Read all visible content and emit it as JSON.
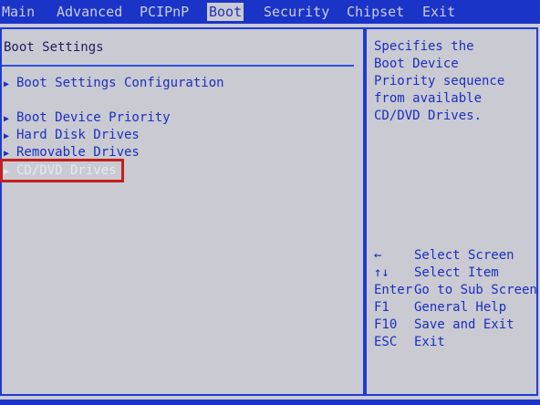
{
  "tabs": [
    {
      "label": "Main"
    },
    {
      "label": "Advanced"
    },
    {
      "label": "PCIPnP"
    },
    {
      "label": "Boot"
    },
    {
      "label": "Security"
    },
    {
      "label": "Chipset"
    },
    {
      "label": "Exit"
    }
  ],
  "active_tab": "Boot",
  "left_panel": {
    "title": "Boot Settings",
    "arrow_icon": "▶",
    "items": [
      {
        "label": "Boot Settings Configuration"
      },
      {
        "label": "Boot Device Priority"
      },
      {
        "label": "Hard Disk Drives"
      },
      {
        "label": "Removable Drives"
      },
      {
        "label": "CD/DVD Drives"
      }
    ],
    "selected_index": 4
  },
  "right_panel": {
    "help": "Specifies the\nBoot Device\nPriority sequence\nfrom available\nCD/DVD Drives.",
    "keys": [
      {
        "key": "←",
        "desc": "Select Screen"
      },
      {
        "key": "↑↓",
        "desc": "Select Item"
      },
      {
        "key": "Enter",
        "desc": "Go to Sub Screen"
      },
      {
        "key": "F1",
        "desc": "General Help"
      },
      {
        "key": "F10",
        "desc": "Save and Exit"
      },
      {
        "key": "ESC",
        "desc": "Exit"
      }
    ]
  },
  "colors": {
    "background": "#c9cad2",
    "bar": "#1b34c8",
    "text": "#1c2fc0",
    "highlight_box": "#c21f1f"
  }
}
